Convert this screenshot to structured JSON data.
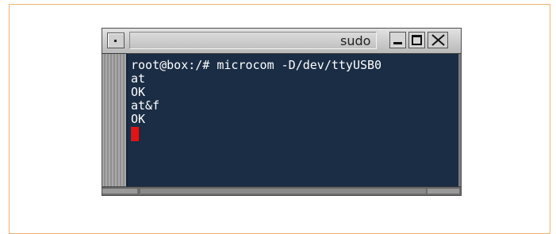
{
  "window": {
    "title": "sudo",
    "controls": {
      "minimize_icon": "minimize-icon",
      "maximize_icon": "maximize-icon",
      "close_icon": "close-icon",
      "menu_icon": "window-menu-icon"
    }
  },
  "terminal": {
    "lines": [
      "root@box:/# microcom -D/dev/ttyUSB0",
      "at",
      "OK",
      "at&f",
      "OK"
    ],
    "background": "#1a2d45",
    "foreground": "#ffffff",
    "cursor_color": "#e01414"
  },
  "colors": {
    "frame_border": "#f0b070"
  }
}
